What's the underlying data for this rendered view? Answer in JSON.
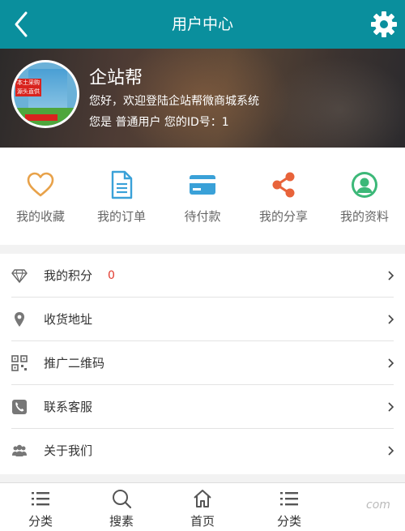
{
  "header": {
    "title": "用户中心"
  },
  "profile": {
    "name": "企站帮",
    "welcome": "您好，欢迎登陆企站帮微商城系统",
    "info": "您是 普通用户 您的ID号：1",
    "avatar_text": "本土采购\n源头直供"
  },
  "actions": [
    {
      "label": "我的收藏",
      "icon": "heart-icon",
      "color": "#e8a24a"
    },
    {
      "label": "我的订单",
      "icon": "document-icon",
      "color": "#3aa1d8"
    },
    {
      "label": "待付款",
      "icon": "card-icon",
      "color": "#3aa1d8"
    },
    {
      "label": "我的分享",
      "icon": "share-icon",
      "color": "#e8633a"
    },
    {
      "label": "我的资料",
      "icon": "user-icon",
      "color": "#3cb878"
    }
  ],
  "menu": [
    {
      "label": "我的积分",
      "value": "0",
      "icon": "diamond-icon"
    },
    {
      "label": "收货地址",
      "icon": "location-icon"
    },
    {
      "label": "推广二维码",
      "icon": "qrcode-icon"
    },
    {
      "label": "联系客服",
      "icon": "phone-icon"
    },
    {
      "label": "关于我们",
      "icon": "group-icon"
    }
  ],
  "nav": [
    {
      "label": "分类",
      "icon": "list-icon"
    },
    {
      "label": "搜素",
      "icon": "search-icon"
    },
    {
      "label": "首页",
      "icon": "home-icon"
    },
    {
      "label": "分类",
      "icon": "list-icon"
    }
  ],
  "watermark": "com"
}
